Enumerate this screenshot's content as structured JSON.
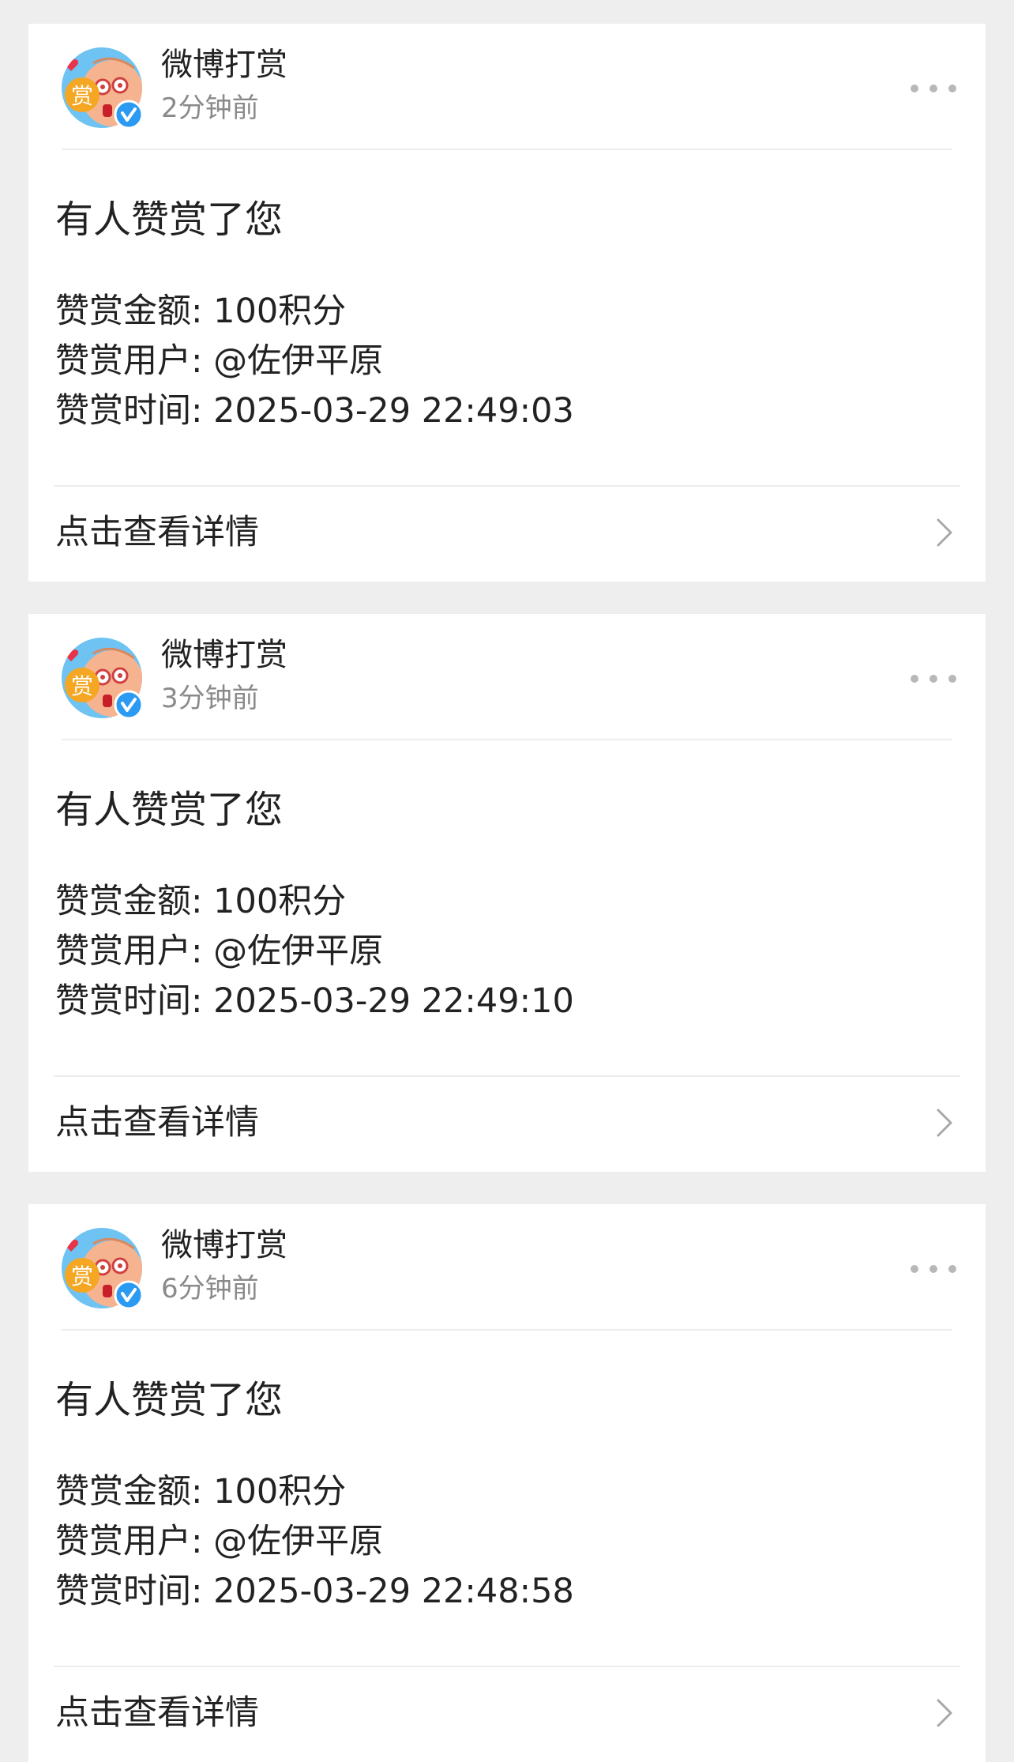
{
  "notifications": [
    {
      "sender": "微博打赏",
      "time": "2分钟前",
      "title": "有人赞赏了您",
      "amount": "赞赏金额: 100积分",
      "user": "赞赏用户: @佐伊平原",
      "reward_time": "赞赏时间: 2025-03-29 22:49:03",
      "action": "点击查看详情"
    },
    {
      "sender": "微博打赏",
      "time": "3分钟前",
      "title": "有人赞赏了您",
      "amount": "赞赏金额: 100积分",
      "user": "赞赏用户: @佐伊平原",
      "reward_time": "赞赏时间: 2025-03-29 22:49:10",
      "action": "点击查看详情"
    },
    {
      "sender": "微博打赏",
      "time": "6分钟前",
      "title": "有人赞赏了您",
      "amount": "赞赏金额: 100积分",
      "user": "赞赏用户: @佐伊平原",
      "reward_time": "赞赏时间: 2025-03-29 22:48:58",
      "action": "点击查看详情"
    }
  ],
  "avatar": {
    "badge_char": "赏",
    "icon": "reward-mascot-avatar"
  },
  "icons": {
    "verified": "verified-check-icon",
    "more": "more-dots-icon",
    "chevron": "chevron-right-icon"
  },
  "colors": {
    "page_background": "#eeeeee",
    "card_background": "#ffffff",
    "primary_text": "#222222",
    "secondary_text": "#8a8a8a",
    "divider": "#ececec",
    "verified_blue": "#2b9af3",
    "avatar_orange": "#f5a623",
    "avatar_sky": "#6ec3f2"
  }
}
